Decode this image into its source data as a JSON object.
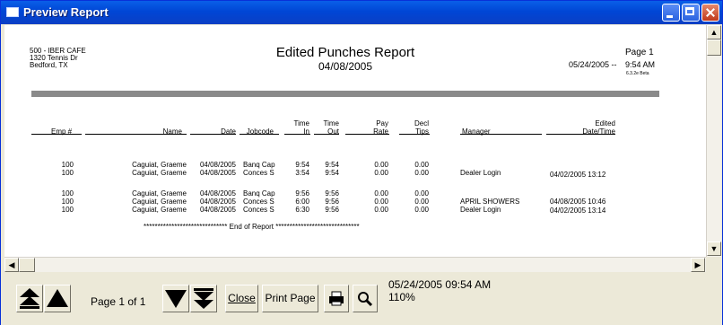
{
  "window": {
    "title": "Preview Report"
  },
  "report": {
    "store_line": "500 - IBER CAFE",
    "address_line": "1320 Tennis Dr",
    "city_line": "Bedford, TX",
    "title": "Edited Punches Report",
    "date": "04/08/2005",
    "print_range": "05/24/2005 --",
    "page_label": "Page 1",
    "print_time": "9:54 AM",
    "version": "6.3.2e Beta",
    "columns": {
      "emp": "Emp #",
      "name": "Name",
      "date": "Date",
      "jobcode": "Jobcode",
      "time_in_1": "Time",
      "time_in_2": "In",
      "time_out_1": "Time",
      "time_out_2": "Out",
      "pay_rate_1": "Pay",
      "pay_rate_2": "Rate",
      "decl_tips_1": "Decl",
      "decl_tips_2": "Tips",
      "manager": "Manager",
      "edited_1": "Edited",
      "edited_2": "Date/Time"
    },
    "rows": [
      {
        "emp": "100",
        "name": "Caguiat, Graeme",
        "date": "04/08/2005",
        "jobcode": "Banq Cap",
        "in": "9:54",
        "out": "9:54",
        "rate": "0.00",
        "tips": "0.00",
        "manager": "",
        "edited": ""
      },
      {
        "emp": "100",
        "name": "Caguiat, Graeme",
        "date": "04/08/2005",
        "jobcode": "Conces S",
        "in": "3:54",
        "out": "9:54",
        "rate": "0.00",
        "tips": "0.00",
        "manager": "Dealer Login",
        "edited": "04/02/2005 13:12"
      },
      {
        "emp": "100",
        "name": "Caguiat, Graeme",
        "date": "04/08/2005",
        "jobcode": "Banq Cap",
        "in": "9:56",
        "out": "9:56",
        "rate": "0.00",
        "tips": "0.00",
        "manager": "",
        "edited": ""
      },
      {
        "emp": "100",
        "name": "Caguiat, Graeme",
        "date": "04/08/2005",
        "jobcode": "Conces S",
        "in": "6:00",
        "out": "9:56",
        "rate": "0.00",
        "tips": "0.00",
        "manager": "APRIL SHOWERS",
        "edited": "04/08/2005 10:46"
      },
      {
        "emp": "100",
        "name": "Caguiat, Graeme",
        "date": "04/08/2005",
        "jobcode": "Conces S",
        "in": "6:30",
        "out": "9:56",
        "rate": "0.00",
        "tips": "0.00",
        "manager": "Dealer Login",
        "edited": "04/02/2005 13:14"
      }
    ],
    "end_marker": "******************************  End of Report  ******************************"
  },
  "toolbar": {
    "page_info": "Page 1 of 1",
    "close_label": "Close",
    "print_page_label": "Print Page",
    "timestamp": "05/24/2005 09:54 AM",
    "zoom": "110%"
  }
}
